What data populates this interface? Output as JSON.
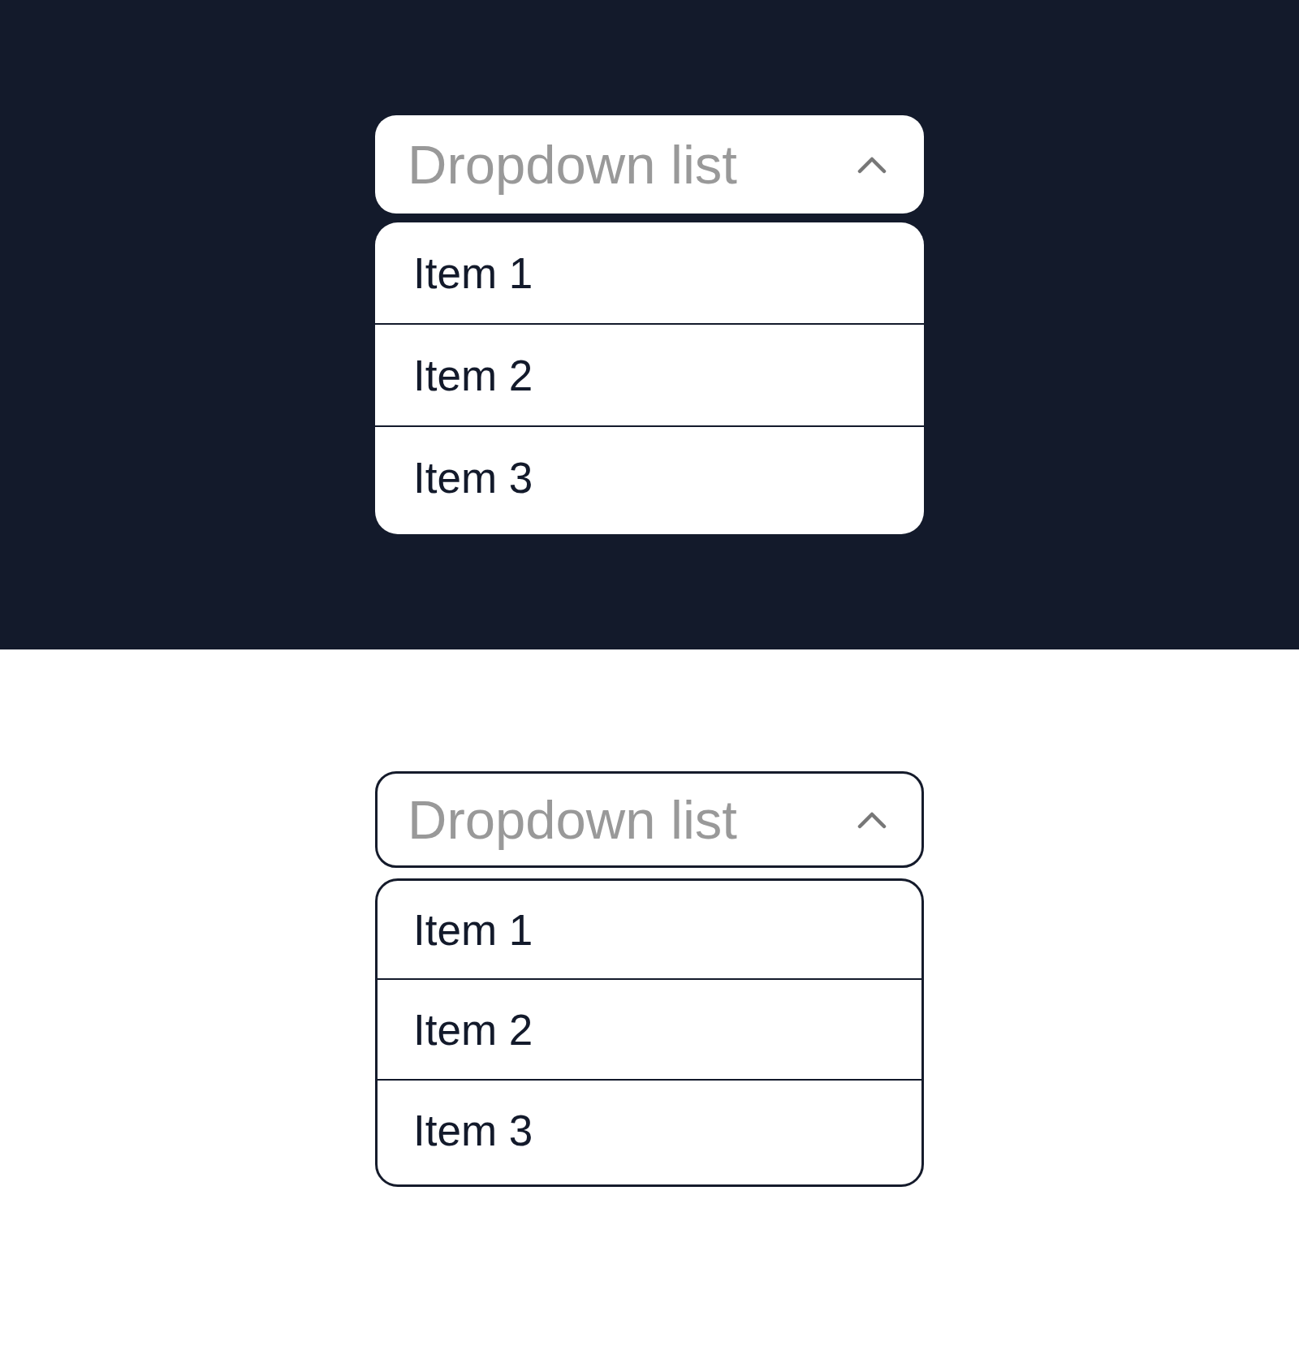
{
  "panels": [
    {
      "kind": "filled",
      "dropdown": {
        "placeholder": "Dropdown list",
        "expanded": true,
        "items": [
          {
            "label": "Item 1"
          },
          {
            "label": "Item 2"
          },
          {
            "label": "Item 3"
          }
        ]
      }
    },
    {
      "kind": "outlined",
      "dropdown": {
        "placeholder": "Dropdown list",
        "expanded": true,
        "items": [
          {
            "label": "Item 1"
          },
          {
            "label": "Item 2"
          },
          {
            "label": "Item 3"
          }
        ]
      }
    }
  ]
}
